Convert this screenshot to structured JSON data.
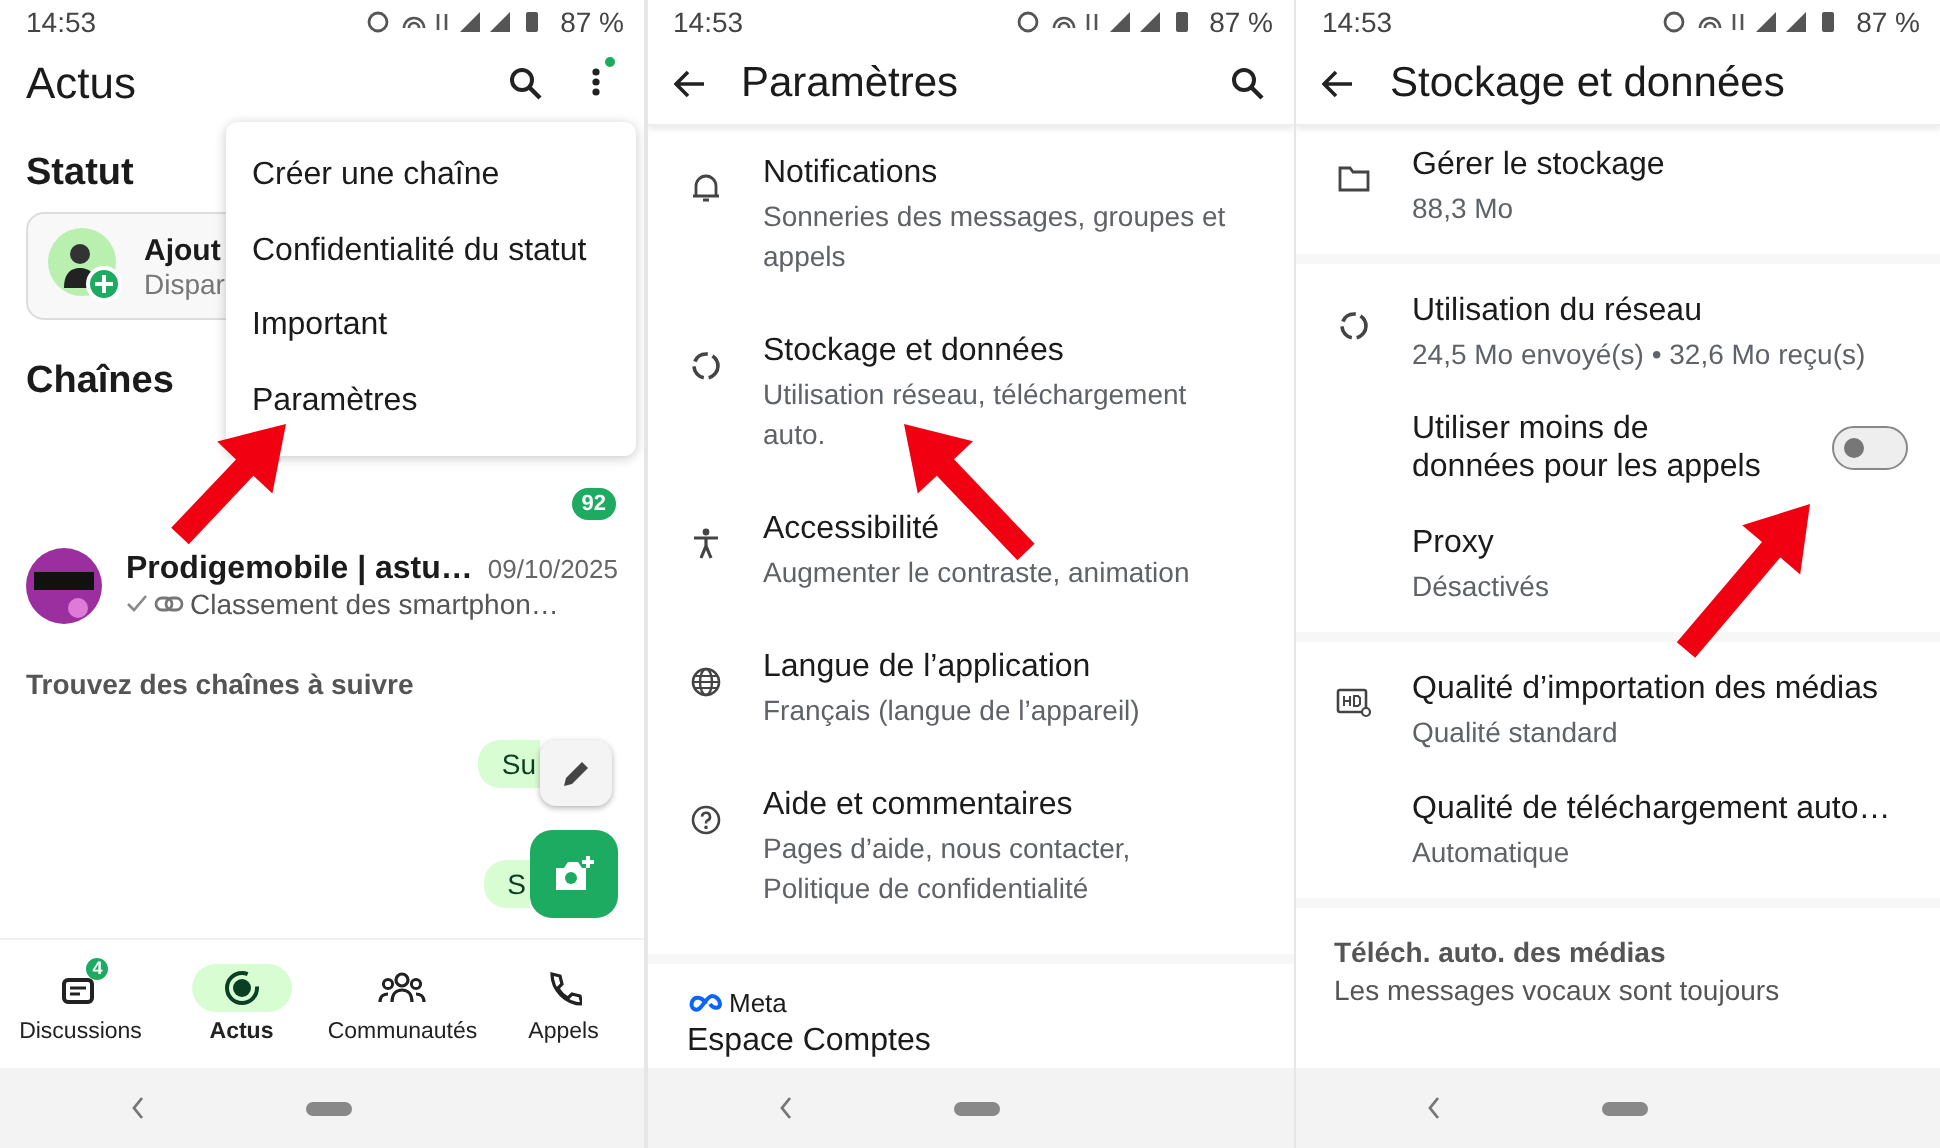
{
  "status_bars": [
    {
      "time": "14:53",
      "battery": "87 %"
    },
    {
      "time": "14:53",
      "battery": "87 %"
    },
    {
      "time": "14:53",
      "battery": "87 %"
    }
  ],
  "actus": {
    "title": "Actus",
    "status_heading": "Statut",
    "status_card": {
      "title": "Ajout",
      "subtitle": "Dispar"
    },
    "channels_heading": "Chaînes",
    "unread_count": "92",
    "channels": [
      {
        "name": "Prodigemobile | astu…",
        "date": "09/10/2025",
        "preview": "Classement des smartphon…"
      }
    ],
    "suggest_heading": "Trouvez des chaînes à suivre",
    "follow_buttons": [
      "Su",
      "S"
    ],
    "menu": [
      "Créer une chaîne",
      "Confidentialité du statut",
      "Important",
      "Paramètres"
    ],
    "nav": [
      {
        "label": "Discussions",
        "selected": false,
        "badge": "4"
      },
      {
        "label": "Actus",
        "selected": true
      },
      {
        "label": "Communautés",
        "selected": false
      },
      {
        "label": "Appels",
        "selected": false
      }
    ]
  },
  "settings": {
    "title": "Paramètres",
    "items": [
      {
        "title": "Notifications",
        "subtitle": "Sonneries des messages, groupes et appels"
      },
      {
        "title": "Stockage et données",
        "subtitle": "Utilisation réseau, téléchargement auto."
      },
      {
        "title": "Accessibilité",
        "subtitle": "Augmenter le contraste, animation"
      },
      {
        "title": "Langue de l’application",
        "subtitle": "Français (langue de l’appareil)"
      },
      {
        "title": "Aide et commentaires",
        "subtitle": "Pages d’aide, nous contacter, Politique de confidentialité"
      }
    ],
    "meta_label": "Meta",
    "account_center": "Espace Comptes"
  },
  "storage": {
    "title": "Stockage et données",
    "rows": [
      {
        "kind": "item",
        "title": "Gérer le stockage",
        "subtitle": "88,3 Mo"
      },
      {
        "kind": "divider"
      },
      {
        "kind": "item",
        "title": "Utilisation du réseau",
        "subtitle": "24,5 Mo envoyé(s) • 32,6 Mo reçu(s)"
      },
      {
        "kind": "toggle",
        "title": "Utiliser moins de données pour les appels",
        "on": false
      },
      {
        "kind": "item",
        "title": "Proxy",
        "subtitle": "Désactivés"
      },
      {
        "kind": "divider"
      },
      {
        "kind": "item",
        "title": "Qualité d’importation des médias",
        "subtitle": "Qualité standard"
      },
      {
        "kind": "item",
        "title": "Qualité de téléchargement auto…",
        "subtitle": "Automatique"
      },
      {
        "kind": "divider"
      },
      {
        "kind": "section",
        "title": "Téléch. auto. des médias",
        "subtitle": "Les messages vocaux sont toujours"
      }
    ]
  }
}
